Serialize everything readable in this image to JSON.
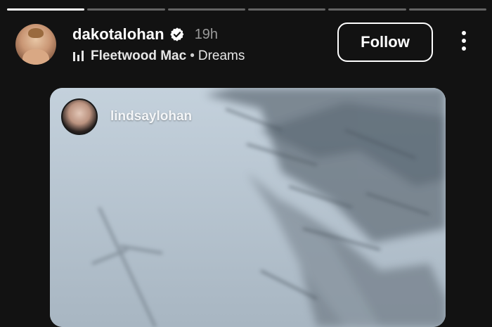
{
  "story": {
    "progress": [
      1.0,
      0.0,
      0.0,
      0.0,
      0.0,
      0.0
    ]
  },
  "header": {
    "username": "dakotalohan",
    "time": "19h",
    "music": {
      "artist": "Fleetwood Mac",
      "separator": "•",
      "song": "Dreams"
    },
    "follow_label": "Follow"
  },
  "card": {
    "username": "lindsaylohan"
  },
  "icons": {
    "verified": "verified-badge-icon",
    "music": "music-bars-icon",
    "more": "more-vertical-icon"
  },
  "colors": {
    "background": "#121212",
    "secondary_text": "#9a9a9a",
    "verified_badge": "#ffffff"
  }
}
